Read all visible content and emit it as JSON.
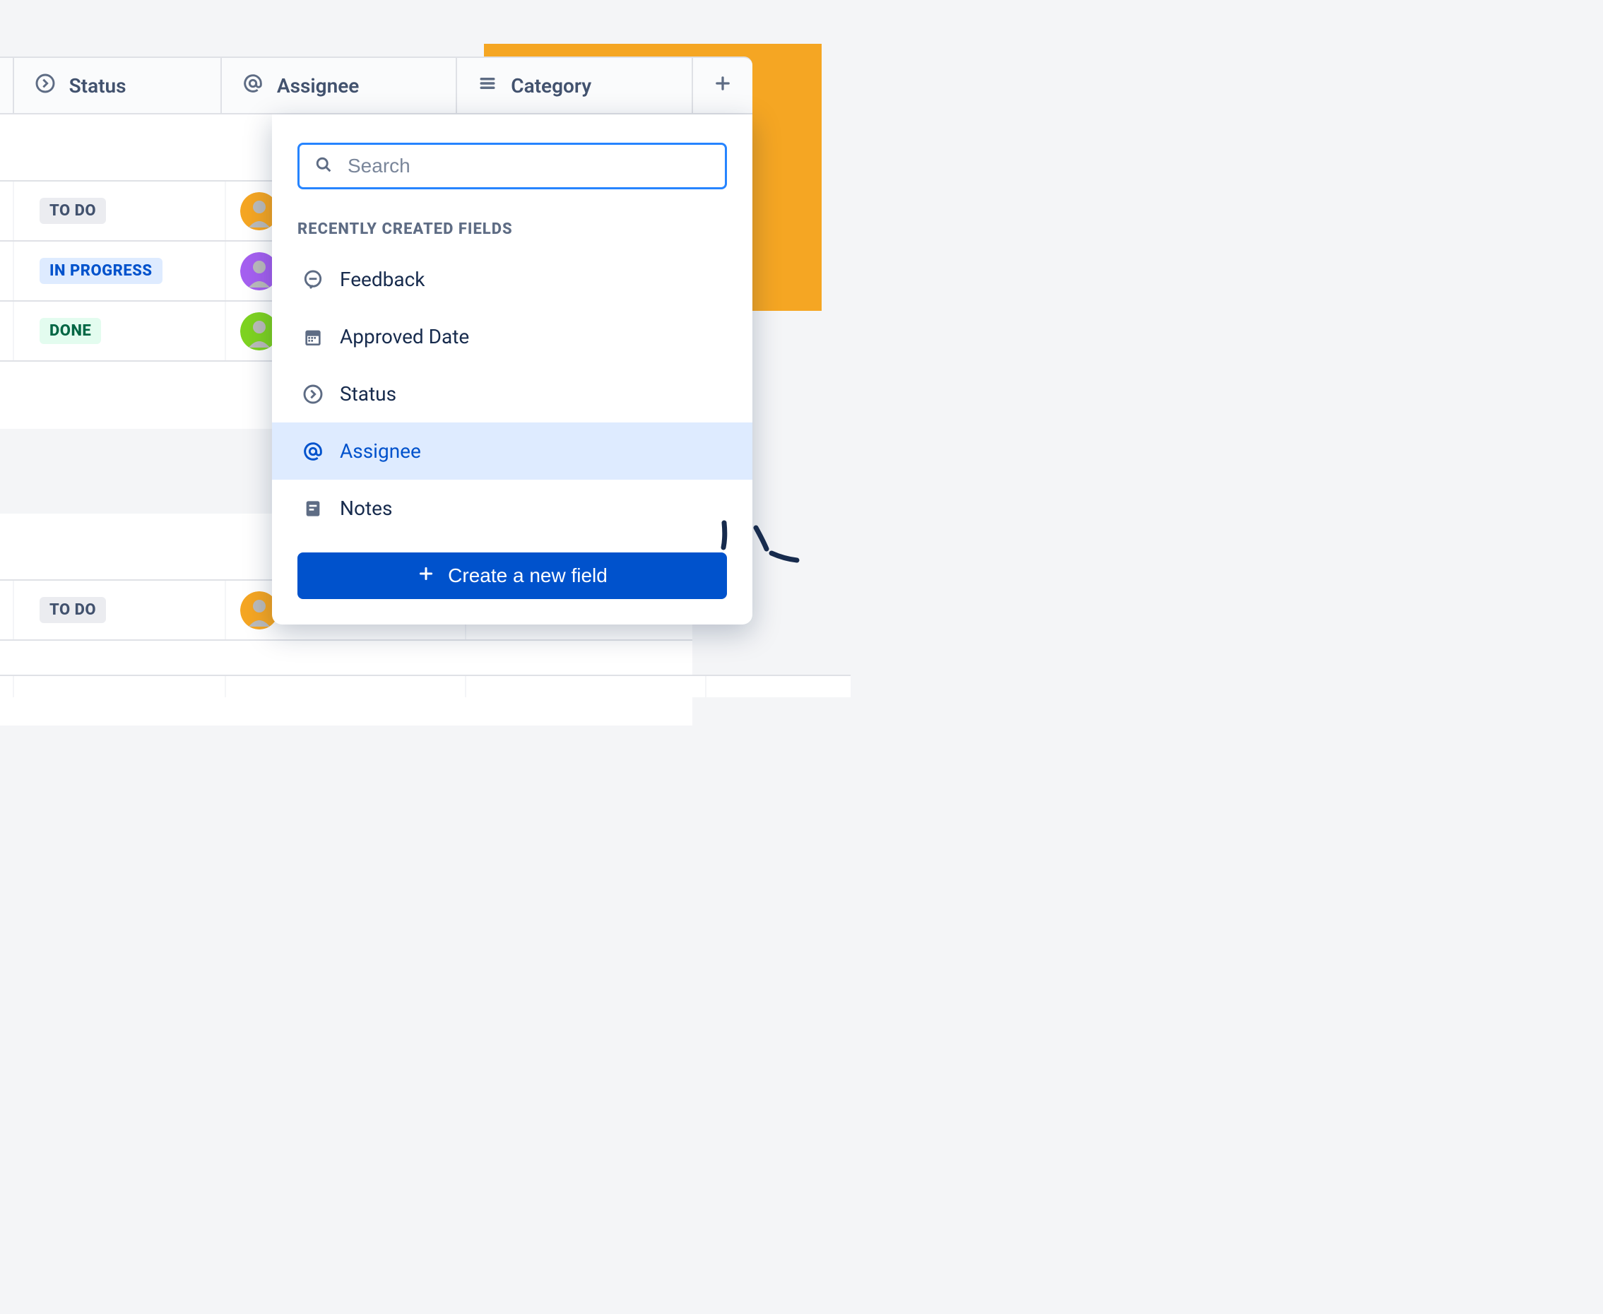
{
  "columns": {
    "status": "Status",
    "assignee": "Assignee",
    "category": "Category"
  },
  "rows": [
    {
      "status_label": "TO DO",
      "status_kind": "todo",
      "avatar_bg": "#f5a623"
    },
    {
      "status_label": "IN PROGRESS",
      "status_kind": "inprogress",
      "avatar_bg": "#a560f0"
    },
    {
      "status_label": "DONE",
      "status_kind": "done",
      "avatar_bg": "#7ed321"
    }
  ],
  "rows2": [
    {
      "status_label": "TO DO",
      "status_kind": "todo",
      "avatar_bg": "#f5a623"
    }
  ],
  "dropdown": {
    "search_placeholder": "Search",
    "section_label": "RECENTLY CREATED FIELDS",
    "items": [
      {
        "label": "Feedback",
        "icon": "chat"
      },
      {
        "label": "Approved Date",
        "icon": "calendar"
      },
      {
        "label": "Status",
        "icon": "arrow-circle"
      },
      {
        "label": "Assignee",
        "icon": "at",
        "highlighted": true
      },
      {
        "label": "Notes",
        "icon": "note"
      }
    ],
    "create_label": "Create a new field"
  }
}
